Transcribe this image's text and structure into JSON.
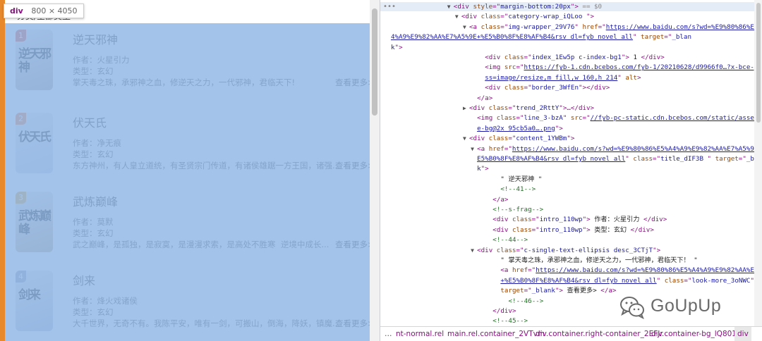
{
  "page": {
    "header": "分类/全部类型",
    "tooltip": {
      "tag": "div",
      "size": "800 × 4050"
    },
    "novels": [
      {
        "rank": "1",
        "title": "逆天邪神",
        "author": "作者：火星引力",
        "type": "类型：玄幻",
        "desc": "掌天毒之珠，承邪神之血，修逆天之力，一代邪神，君临天下!",
        "desc_extra": "",
        "more": "查看更多>",
        "cover_text": "逆天邪神",
        "cover_color": "#b5a79a",
        "rank_color": "#e2553f"
      },
      {
        "rank": "2",
        "title": "伏天氏",
        "author": "作者：净无痕",
        "type": "类型：玄幻",
        "desc": "东方神州，有人皇立道统，有圣贤宗门传道，有诸侯雄踞一方王国，诸强...",
        "desc_extra": "",
        "more": "查看更多>",
        "cover_text": "伏天氏",
        "cover_color": "#c9d2da",
        "rank_color": "#f0803c"
      },
      {
        "rank": "3",
        "title": "武炼巅峰",
        "author": "作者：莫默",
        "type": "类型：玄幻",
        "desc": "武之巅峰，是孤独，是寂寞，是漫漫求索，是高处不胜寒",
        "desc_extra": "逆境中成长...",
        "more": "查看更多>",
        "cover_text": "武炼巅峰",
        "cover_color": "#bfae8a",
        "rank_color": "#e9a63a"
      },
      {
        "rank": "4",
        "title": "剑来",
        "author": "作者：烽火戏诸侯",
        "type": "类型：玄幻",
        "desc": "大千世界，无奇不有。我陈平安，唯有一剑，可搬山，倒海，降妖，镇魔...",
        "desc_extra": "",
        "more": "查看更多>",
        "cover_text": "剑来",
        "cover_color": "#b7bfc9",
        "rank_color": "#9aa3ad"
      }
    ]
  },
  "devtools": {
    "lines": [
      {
        "indent": 16,
        "tri": "▼",
        "sel": true,
        "parts": [
          [
            "t",
            "<div "
          ],
          [
            "a",
            "style"
          ],
          [
            "t",
            "=\""
          ],
          [
            "v",
            "margin-bottom:20px"
          ],
          [
            "t",
            "\">"
          ],
          [
            "g",
            " == $0"
          ]
        ]
      },
      {
        "indent": 18,
        "tri": "▼",
        "parts": [
          [
            "t",
            "<div "
          ],
          [
            "a",
            "class"
          ],
          [
            "t",
            "=\""
          ],
          [
            "v",
            "category-wrap_iQLoo "
          ],
          [
            "t",
            "\">"
          ]
        ]
      },
      {
        "indent": 20,
        "tri": "▼",
        "parts": [
          [
            "t",
            "<a "
          ],
          [
            "a",
            "class"
          ],
          [
            "t",
            "=\""
          ],
          [
            "v",
            "img-wrapper_29V76"
          ],
          [
            "t",
            "\" "
          ],
          [
            "a",
            "href"
          ],
          [
            "t",
            "=\""
          ],
          [
            "u",
            "https://www.baidu.com/s?wd=%E9%80%86%E5%A"
          ]
        ]
      },
      {
        "indent": 0,
        "tri": "",
        "parts": [
          [
            "u",
            "4%A9%E9%82%AA%E7%A5%9E+%E5%B0%8F%E8%AF%B4&rsv_dl=fyb_novel_all"
          ],
          [
            "t",
            "\" "
          ],
          [
            "a",
            "target"
          ],
          [
            "t",
            "=\""
          ],
          [
            "v",
            "_blan"
          ]
        ]
      },
      {
        "indent": 0,
        "tri": "",
        "parts": [
          [
            "v",
            "k"
          ],
          [
            "t",
            "\">"
          ]
        ]
      },
      {
        "indent": 24,
        "tri": "",
        "parts": [
          [
            "t",
            "<div "
          ],
          [
            "a",
            "class"
          ],
          [
            "t",
            "=\""
          ],
          [
            "v",
            "index_1Ew5p c-index-bg1"
          ],
          [
            "t",
            "\"> "
          ],
          [
            "tx",
            "1 "
          ],
          [
            "t",
            "</div>"
          ]
        ]
      },
      {
        "indent": 24,
        "tri": "",
        "parts": [
          [
            "t",
            "<img "
          ],
          [
            "a",
            "src"
          ],
          [
            "t",
            "=\""
          ],
          [
            "u",
            "https://fyb-1.cdn.bcebos.com/fyb-1/20210628/d9966f0…?x-bce-proce"
          ]
        ]
      },
      {
        "indent": 24,
        "tri": "",
        "parts": [
          [
            "u",
            "ss=image/resize,m_fill,w_160,h_214"
          ],
          [
            "t",
            "\" "
          ],
          [
            "a",
            "alt"
          ],
          [
            "t",
            ">"
          ]
        ]
      },
      {
        "indent": 24,
        "tri": "",
        "parts": [
          [
            "t",
            "<div "
          ],
          [
            "a",
            "class"
          ],
          [
            "t",
            "=\""
          ],
          [
            "v",
            "border_3WfEn"
          ],
          [
            "t",
            "\"></div>"
          ]
        ]
      },
      {
        "indent": 22,
        "tri": "",
        "parts": [
          [
            "t",
            "</a>"
          ]
        ]
      },
      {
        "indent": 20,
        "tri": "▶",
        "parts": [
          [
            "t",
            "<div "
          ],
          [
            "a",
            "class"
          ],
          [
            "t",
            "=\""
          ],
          [
            "v",
            "trend_2RttY"
          ],
          [
            "t",
            "\">…</div>"
          ]
        ]
      },
      {
        "indent": 22,
        "tri": "",
        "parts": [
          [
            "t",
            "<img "
          ],
          [
            "a",
            "class"
          ],
          [
            "t",
            "=\""
          ],
          [
            "v",
            "line_3-bzA"
          ],
          [
            "t",
            "\" "
          ],
          [
            "a",
            "src"
          ],
          [
            "t",
            "=\""
          ],
          [
            "u",
            "//fyb-pc-static.cdn.bcebos.com/static/asset/lin"
          ]
        ]
      },
      {
        "indent": 22,
        "tri": "",
        "parts": [
          [
            "u",
            "e-bg@2x_95cb5a0….png"
          ],
          [
            "t",
            "\">"
          ]
        ]
      },
      {
        "indent": 20,
        "tri": "▼",
        "parts": [
          [
            "t",
            "<div "
          ],
          [
            "a",
            "class"
          ],
          [
            "t",
            "=\""
          ],
          [
            "v",
            "content_1YWBm"
          ],
          [
            "t",
            "\">"
          ]
        ]
      },
      {
        "indent": 22,
        "tri": "▼",
        "parts": [
          [
            "t",
            "<a "
          ],
          [
            "a",
            "href"
          ],
          [
            "t",
            "=\""
          ],
          [
            "u",
            "https://www.baidu.com/s?wd=%E9%80%86%E5%A4%A9%E9%82%AA%E7%A5%9E+%"
          ]
        ]
      },
      {
        "indent": 22,
        "tri": "",
        "parts": [
          [
            "u",
            "E5%B0%8F%E8%AF%B4&rsv_dl=fyb_novel_all"
          ],
          [
            "t",
            "\" "
          ],
          [
            "a",
            "class"
          ],
          [
            "t",
            "=\""
          ],
          [
            "v",
            "title_dIF3B "
          ],
          [
            "t",
            "\" "
          ],
          [
            "a",
            "target"
          ],
          [
            "t",
            "=\""
          ],
          [
            "v",
            "_blan"
          ]
        ]
      },
      {
        "indent": 22,
        "tri": "",
        "parts": [
          [
            "v",
            "k"
          ],
          [
            "t",
            "\">"
          ]
        ]
      },
      {
        "indent": 28,
        "tri": "",
        "parts": [
          [
            "tx",
            "\" 逆天邪神 \""
          ]
        ]
      },
      {
        "indent": 28,
        "tri": "",
        "parts": [
          [
            "c",
            "<!--41-->"
          ]
        ]
      },
      {
        "indent": 26,
        "tri": "",
        "parts": [
          [
            "t",
            "</a>"
          ]
        ]
      },
      {
        "indent": 26,
        "tri": "",
        "parts": [
          [
            "c",
            "<!--s-frag-->"
          ]
        ]
      },
      {
        "indent": 26,
        "tri": "",
        "parts": [
          [
            "t",
            "<div "
          ],
          [
            "a",
            "class"
          ],
          [
            "t",
            "=\""
          ],
          [
            "v",
            "intro_110wp"
          ],
          [
            "t",
            "\"> "
          ],
          [
            "tx",
            "作者：火星引力 "
          ],
          [
            "t",
            "</div>"
          ]
        ]
      },
      {
        "indent": 26,
        "tri": "",
        "parts": [
          [
            "t",
            "<div "
          ],
          [
            "a",
            "class"
          ],
          [
            "t",
            "=\""
          ],
          [
            "v",
            "intro_110wp"
          ],
          [
            "t",
            "\"> "
          ],
          [
            "tx",
            "类型：玄幻 "
          ],
          [
            "t",
            "</div>"
          ]
        ]
      },
      {
        "indent": 26,
        "tri": "",
        "parts": [
          [
            "c",
            "<!--44-->"
          ]
        ]
      },
      {
        "indent": 22,
        "tri": "▼",
        "parts": [
          [
            "t",
            "<div "
          ],
          [
            "a",
            "class"
          ],
          [
            "t",
            "=\""
          ],
          [
            "v",
            "c-single-text-ellipsis desc_3CTjT"
          ],
          [
            "t",
            "\">"
          ]
        ]
      },
      {
        "indent": 28,
        "tri": "",
        "parts": [
          [
            "tx",
            "\" 掌天毒之珠，承邪神之血，修逆天之力，一代邪神，君临天下！ \""
          ]
        ]
      },
      {
        "indent": 28,
        "tri": "",
        "parts": [
          [
            "t",
            "<a "
          ],
          [
            "a",
            "href"
          ],
          [
            "t",
            "=\""
          ],
          [
            "u",
            "https://www.baidu.com/s?wd=%E9%80%86%E5%A4%A9%E9%82%AA%E7%A5%9E"
          ]
        ]
      },
      {
        "indent": 28,
        "tri": "",
        "parts": [
          [
            "u",
            "+%E5%B0%8F%E8%AF%B4&rsv_dl=fyb_novel_all"
          ],
          [
            "t",
            "\" "
          ],
          [
            "a",
            "class"
          ],
          [
            "t",
            "=\""
          ],
          [
            "v",
            "look-more_3oNWC"
          ],
          [
            "t",
            "\""
          ]
        ]
      },
      {
        "indent": 28,
        "tri": "",
        "parts": [
          [
            "a",
            "target"
          ],
          [
            "t",
            "=\""
          ],
          [
            "v",
            "_blank"
          ],
          [
            "t",
            "\"> "
          ],
          [
            "tx",
            "查看更多> "
          ],
          [
            "t",
            "</a>"
          ]
        ]
      },
      {
        "indent": 30,
        "tri": "",
        "parts": [
          [
            "c",
            "<!--46-->"
          ]
        ]
      },
      {
        "indent": 26,
        "tri": "",
        "parts": [
          [
            "t",
            "</div>"
          ]
        ]
      },
      {
        "indent": 26,
        "tri": "",
        "parts": [
          [
            "c",
            "<!--45-->"
          ]
        ]
      },
      {
        "indent": 26,
        "tri": "",
        "parts": [
          [
            "c",
            "<!--/s-frag-->"
          ]
        ]
      }
    ],
    "breadcrumbs": [
      "nt-normal.rel",
      "main.rel.container_2VTvm",
      "div.container.right-container_2EFJr",
      "div.container-bg_lQ801",
      "div"
    ],
    "breadcrumb_dots": "…"
  },
  "watermark": {
    "text": "GoUpUp",
    "icon": "wechat-icon"
  },
  "colors": {
    "highlight": "#8fb6e6",
    "orange": "#e8892c",
    "tag": "#881280",
    "attr": "#994500",
    "value": "#1a1aa6"
  }
}
